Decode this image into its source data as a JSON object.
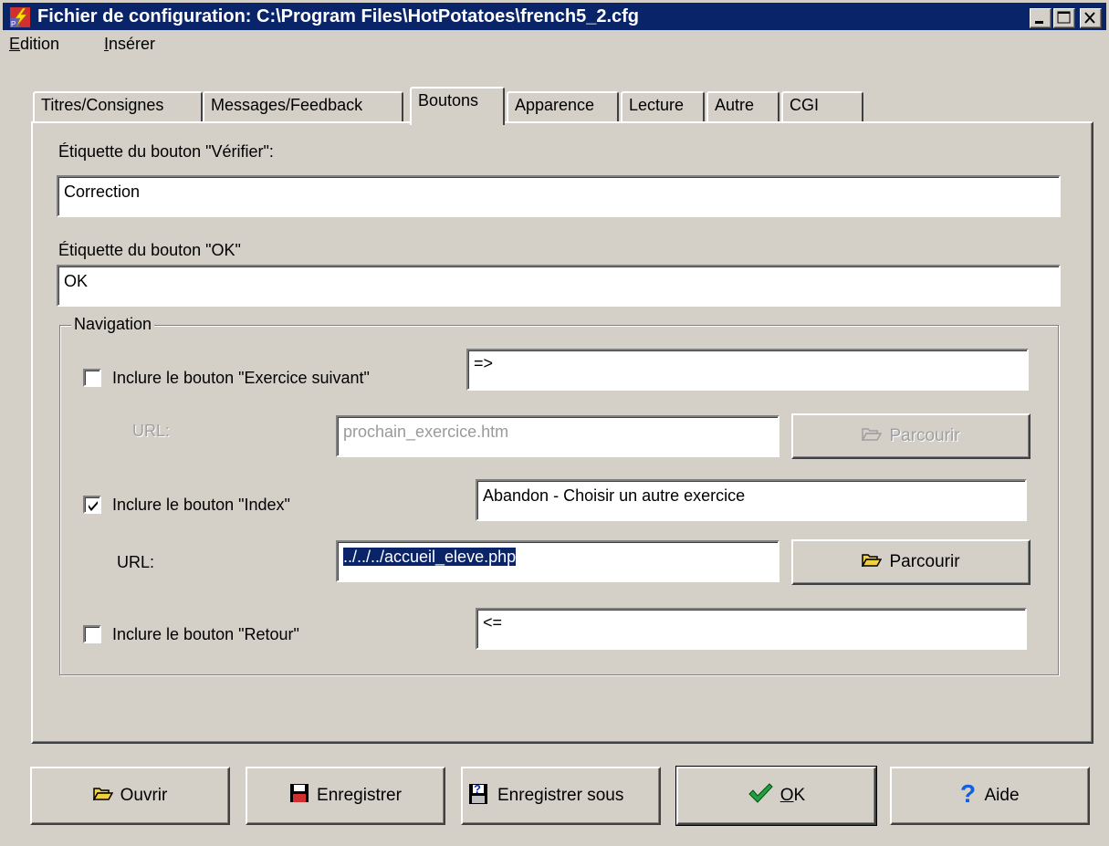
{
  "window": {
    "title": "Fichier de configuration: C:\\Program Files\\HotPotatoes\\french5_2.cfg"
  },
  "menu": {
    "items": [
      {
        "accel": "E",
        "rest": "dition"
      },
      {
        "accel": "I",
        "rest": "nsérer"
      }
    ]
  },
  "tabs": [
    {
      "label": "Titres/Consignes"
    },
    {
      "label": "Messages/Feedback"
    },
    {
      "label": "Boutons"
    },
    {
      "label": "Apparence"
    },
    {
      "label": "Lecture"
    },
    {
      "label": "Autre"
    },
    {
      "label": "CGI"
    }
  ],
  "active_tab": "Boutons",
  "boutons": {
    "verifier_label": "Étiquette du bouton \"Vérifier\":",
    "verifier_value": "Correction",
    "ok_label": "Étiquette du bouton \"OK\"",
    "ok_value": "OK"
  },
  "navigation": {
    "legend": "Navigation",
    "next": {
      "label": "Inclure le bouton \"Exercice suivant\"",
      "checked": false,
      "value": "=>",
      "url_label": "URL:",
      "url": "prochain_exercice.htm",
      "browse": "Parcourir"
    },
    "index": {
      "label": "Inclure le bouton \"Index\"",
      "checked": true,
      "value": "Abandon - Choisir un autre exercice",
      "url_label": "URL:",
      "url": "../../../accueil_eleve.php",
      "browse": "Parcourir"
    },
    "back": {
      "label": "Inclure le bouton \"Retour\"",
      "checked": false,
      "value": "<="
    }
  },
  "footer": {
    "open": "Ouvrir",
    "save": "Enregistrer",
    "save_as": "Enregistrer sous",
    "ok_accel": "O",
    "ok_rest": "K",
    "help": "Aide"
  },
  "colors": {
    "titlebar": "#0a246a",
    "face": "#d4d0c8",
    "selection": "#0a246a"
  }
}
